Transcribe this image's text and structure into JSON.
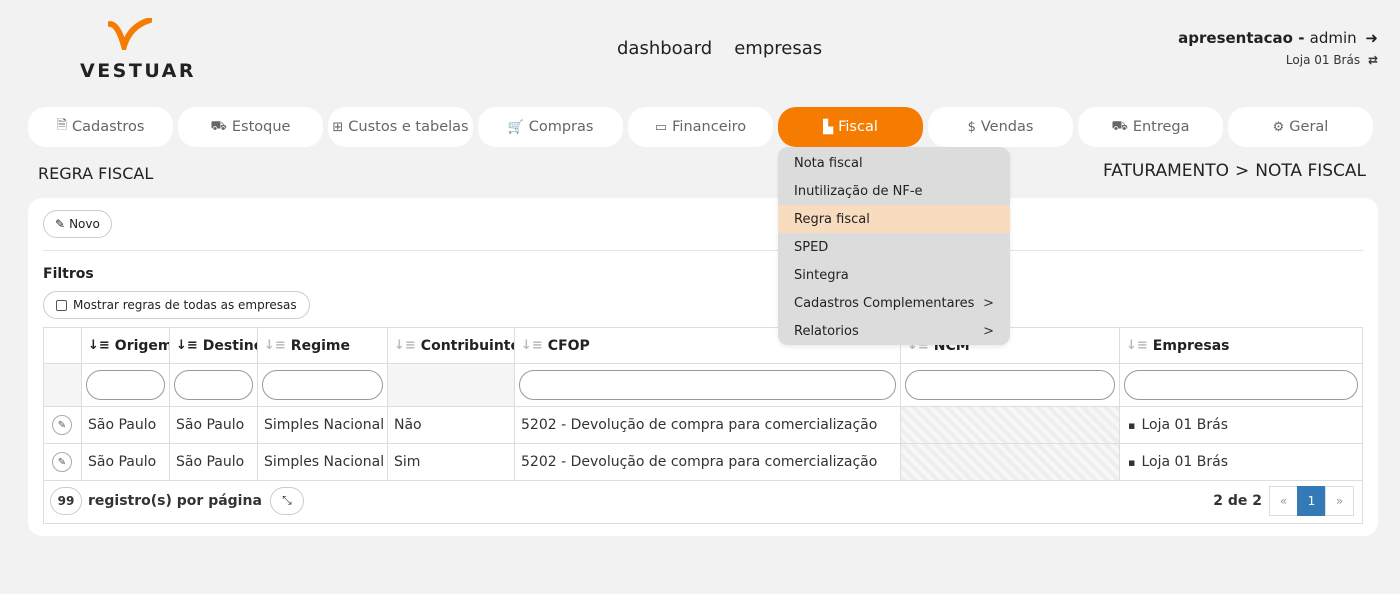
{
  "brand": {
    "name": "VESTUAR",
    "accent": "#f57c00"
  },
  "topnav": [
    "dashboard",
    "empresas"
  ],
  "user": {
    "company": "apresentacao",
    "separator": " - ",
    "role": "admin",
    "store": "Loja 01 Brás",
    "logout_icon": "sign-out-icon",
    "switch_icon": "swap-icon"
  },
  "tabs": [
    {
      "label": "Cadastros",
      "icon": "file-text-icon",
      "glyph": "🗎"
    },
    {
      "label": "Estoque",
      "icon": "truck-icon",
      "glyph": "⛟"
    },
    {
      "label": "Custos e tabelas",
      "icon": "table-icon",
      "glyph": "⊞"
    },
    {
      "label": "Compras",
      "icon": "cart-icon",
      "glyph": "🛒"
    },
    {
      "label": "Financeiro",
      "icon": "credit-card-icon",
      "glyph": "▭"
    },
    {
      "label": "Fiscal",
      "icon": "file-icon",
      "glyph": "▙",
      "active": true
    },
    {
      "label": "Vendas",
      "icon": "dollar-icon",
      "glyph": "$"
    },
    {
      "label": "Entrega",
      "icon": "truck-icon",
      "glyph": "⛟"
    },
    {
      "label": "Geral",
      "icon": "cogs-icon",
      "glyph": "⚙"
    }
  ],
  "fiscal_menu": [
    {
      "label": "Nota fiscal"
    },
    {
      "label": "Inutilização de NF-e"
    },
    {
      "label": "Regra fiscal",
      "highlighted": true
    },
    {
      "label": "SPED"
    },
    {
      "label": "Sintegra"
    },
    {
      "label": "Cadastros Complementares",
      "submenu": ">"
    },
    {
      "label": "Relatorios",
      "submenu": ">"
    }
  ],
  "page": {
    "title": "REGRA FISCAL",
    "breadcrumb": [
      "FATURAMENTO",
      "NOTA FISCAL"
    ],
    "breadcrumb_sep": ">"
  },
  "toolbar": {
    "new_label": "Novo"
  },
  "filters": {
    "heading": "Filtros",
    "show_all_label": "Mostrar regras de todas as empresas"
  },
  "table": {
    "columns": [
      "Origem",
      "Destino",
      "Regime",
      "Contribuinte",
      "CFOP",
      "NCM",
      "Empresas"
    ],
    "rows": [
      {
        "origem": "São Paulo",
        "destino": "São Paulo",
        "regime": "Simples Nacional",
        "contribuinte": "Não",
        "cfop": "5202 - Devolução de compra para comercialização",
        "ncm": "",
        "empresas": "Loja 01 Brás"
      },
      {
        "origem": "São Paulo",
        "destino": "São Paulo",
        "regime": "Simples Nacional",
        "contribuinte": "Sim",
        "cfop": "5202 - Devolução de compra para comercialização",
        "ncm": "",
        "empresas": "Loja 01 Brás"
      }
    ]
  },
  "footer": {
    "per_page": "99",
    "per_page_label": "registro(s) por página",
    "records_info": "2 de 2",
    "prev": "«",
    "page": "1",
    "next": "»"
  }
}
